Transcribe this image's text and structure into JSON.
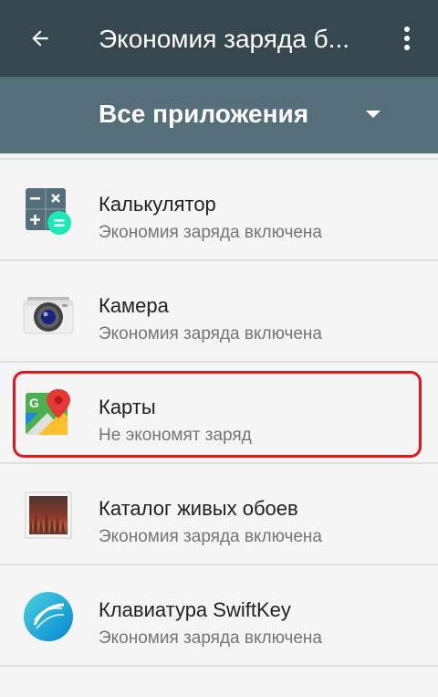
{
  "appbar": {
    "title": "Экономия заряда б...",
    "back_icon": "arrow-back-icon",
    "menu_icon": "more-vert-icon"
  },
  "filter": {
    "selected": "Все приложения",
    "dropdown_icon": "dropdown-arrow-icon"
  },
  "apps": [
    {
      "name": "Калькулятор",
      "status": "Экономия заряда включена",
      "icon": "calculator-icon"
    },
    {
      "name": "Камера",
      "status": "Экономия заряда включена",
      "icon": "camera-icon"
    },
    {
      "name": "Карты",
      "status": "Не экономят заряд",
      "icon": "maps-icon"
    },
    {
      "name": "Каталог живых обоев",
      "status": "Экономия заряда включена",
      "icon": "live-wallpaper-icon"
    },
    {
      "name": "Клавиатура SwiftKey",
      "status": "Экономия заряда включена",
      "icon": "swiftkey-icon"
    }
  ],
  "colors": {
    "appbar": "#37474f",
    "filterbar": "#546e7a",
    "highlight": "#e5141e",
    "background": "#f5f5f5"
  }
}
